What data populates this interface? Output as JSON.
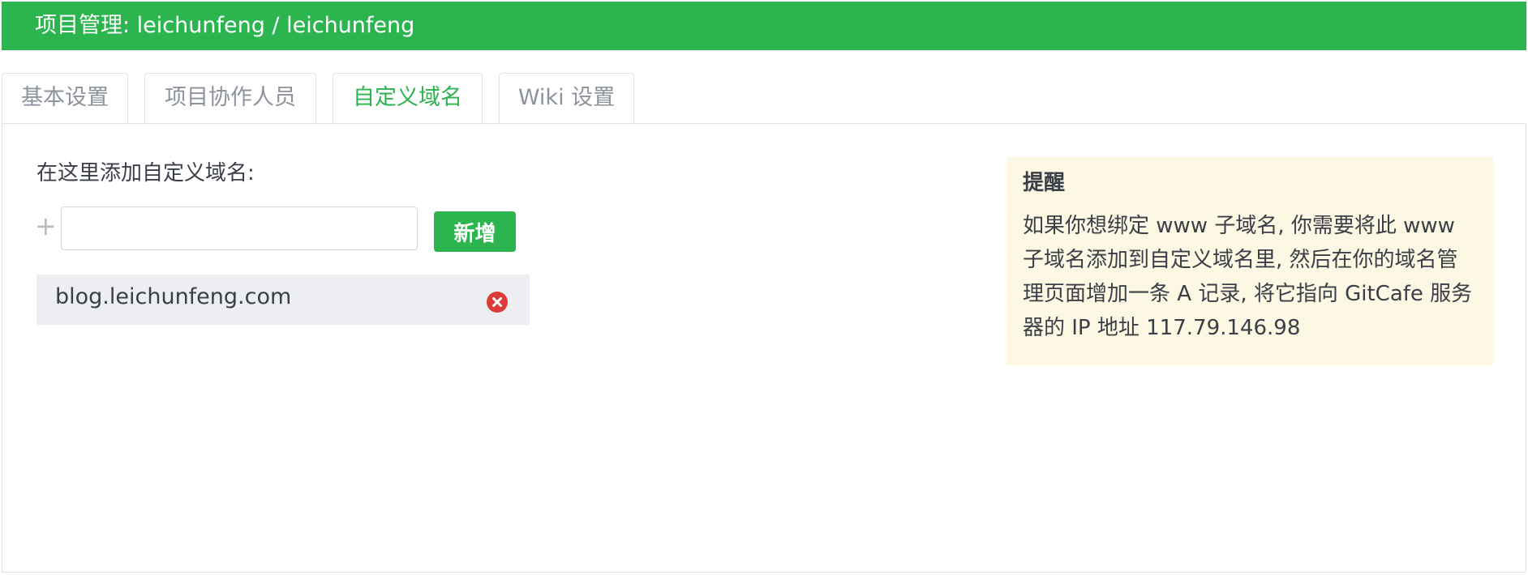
{
  "header": {
    "title": "项目管理: leichunfeng / leichunfeng"
  },
  "tabs": [
    {
      "label": "基本设置"
    },
    {
      "label": "项目协作人员"
    },
    {
      "label": "自定义域名",
      "active": true
    },
    {
      "label": "Wiki 设置"
    }
  ],
  "domains": {
    "add_label": "在这里添加自定义域名:",
    "plus_icon": "+",
    "input_value": "",
    "add_button": "新增",
    "items": [
      {
        "domain": "blog.leichunfeng.com",
        "remove_icon": "close-circle-icon"
      }
    ]
  },
  "notice": {
    "title": "提醒",
    "body": "如果你想绑定 www 子域名, 你需要将此 www 子域名添加到自定义域名里, 然后在你的域名管理页面增加一条 A 记录, 将它指向 GitCafe 服务器的 IP 地址 117.79.146.98"
  },
  "colors": {
    "brand": "#2cb44f",
    "danger": "#de3a3a",
    "notice_bg": "#fdf8e3"
  }
}
